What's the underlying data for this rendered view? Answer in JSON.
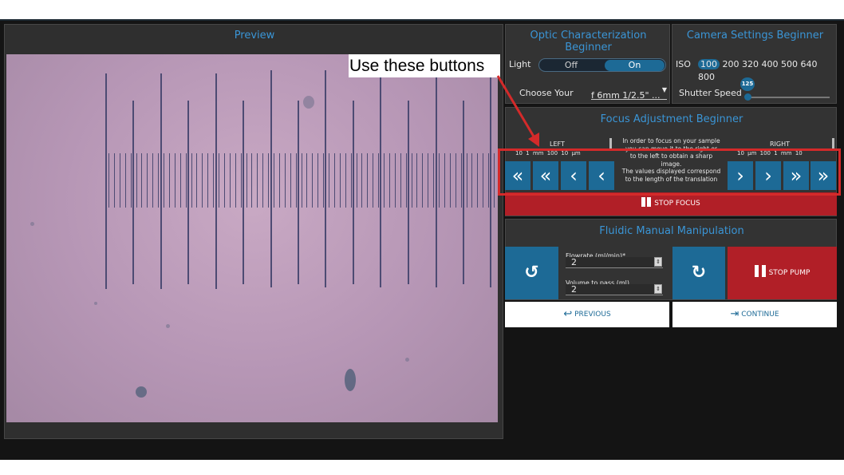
{
  "preview": {
    "title": "Preview"
  },
  "annotation": {
    "text": "Use these buttons",
    "color": "#d42a2a"
  },
  "optic": {
    "title_line1": "Optic Characterization",
    "title_line2": "Beginner",
    "light_label": "Light",
    "light_off": "Off",
    "light_on": "On",
    "choose_label": "Choose Your",
    "objective_value": "f 6mm 1/2.5\" ...",
    "dropdown_icon": "caret-down-icon"
  },
  "camera": {
    "title": "Camera Settings Beginner",
    "iso_label": "ISO",
    "iso_values": [
      "100",
      "200",
      "320",
      "400",
      "500",
      "640",
      "800"
    ],
    "iso_selected": "100",
    "shutter_label": "Shutter Speed",
    "shutter_value": "125"
  },
  "focus": {
    "title": "Focus Adjustment Beginner",
    "left_label": "LEFT",
    "right_label": "RIGHT",
    "left_steps": [
      "10",
      "1 mm",
      "100",
      "10 µm"
    ],
    "right_steps": [
      "10 µm",
      "100",
      "1 mm",
      "10"
    ],
    "help_line1": "In order to focus on your sample",
    "help_line2": "you can move it to the right or",
    "help_line3": "to the left to obtain a sharp",
    "help_line4": "image.",
    "help_line5": "The values displayed correspond",
    "help_line6": "to the length of the translation",
    "left_buttons": [
      "«",
      "«",
      "‹",
      "‹"
    ],
    "right_buttons": [
      "›",
      "›",
      "»",
      "»"
    ],
    "stop_label": "STOP FOCUS"
  },
  "fluidic": {
    "title": "Fluidic Manual Manipulation",
    "flowrate_label": "Flowrate (ml/min)*",
    "flowrate_value": "2",
    "volume_label": "Volume to pass (ml)",
    "volume_value": "2",
    "ccw_icon": "↺",
    "cw_icon": "↻",
    "stop_label": "STOP PUMP"
  },
  "nav": {
    "previous_label": "PREVIOUS",
    "previous_icon": "↩",
    "continue_label": "CONTINUE",
    "continue_icon": "⇥"
  },
  "colors": {
    "accent": "#3a95d6",
    "button_blue": "#1d6a96",
    "stop_red": "#b11f27",
    "background": "#141414"
  }
}
